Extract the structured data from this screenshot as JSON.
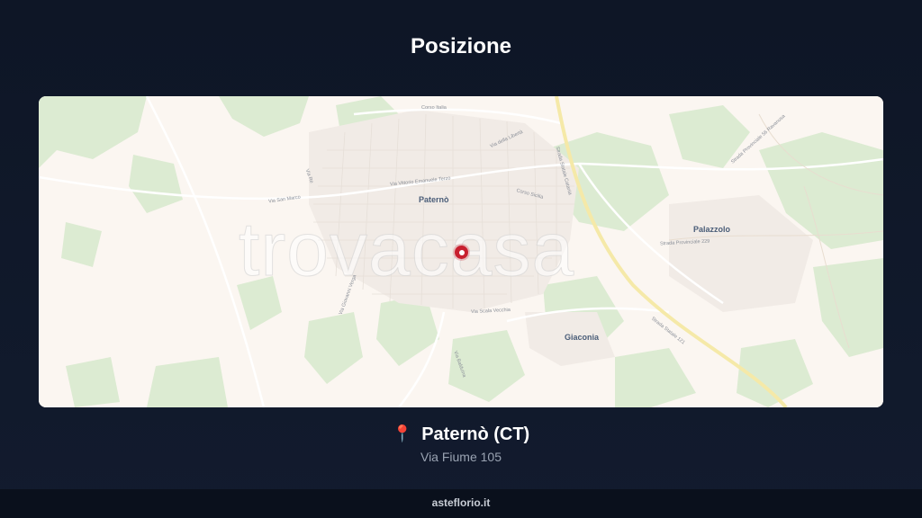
{
  "page": {
    "title": "Posizione"
  },
  "map": {
    "watermark": "trovacasa",
    "marker_icon": "map-marker-icon",
    "labels": {
      "paterno": "Paternò",
      "palazzolo": "Palazzolo",
      "giaconia": "Giaconia",
      "corso_italia": "Corso Italia",
      "via_vittorio_emanuele": "Via Vittorio Emanuele Terzo",
      "corso_sicilia": "Corso Sicilia",
      "via_della_liberta": "Via della Libertà",
      "strada_statale_catania": "Strada Statale Catania",
      "strada_statale_121": "Strada Statale 121",
      "strada_provinciale_229": "Strada Provinciale 229",
      "strada_provinciale_56": "Strada Provinciale 56 Ravanusa",
      "via_san_marco": "Via San Marco",
      "via_re": "Via Re",
      "via_giovanni_verga": "Via Giovanni Verga",
      "via_scala_vecchia": "Via Scala Vecchia",
      "via_balduina": "Via Balduina"
    }
  },
  "location": {
    "pin_icon": "📍",
    "city": "Paternò (CT)",
    "address": "Via Fiume 105"
  },
  "footer": {
    "brand": "asteflorio.it"
  },
  "colors": {
    "background": "#0e1626",
    "map_base": "#fbf6f1",
    "map_green": "#dcebd2",
    "marker": "#c8202f"
  }
}
